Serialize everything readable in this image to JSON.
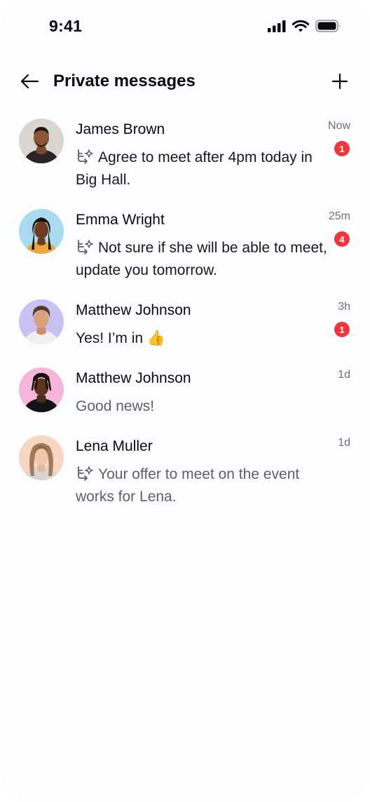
{
  "status_bar": {
    "time": "9:41",
    "icons": [
      "cellular-signal-icon",
      "wifi-icon",
      "battery-icon"
    ]
  },
  "header": {
    "title": "Private messages",
    "back_icon": "arrow-left-icon",
    "add_icon": "plus-icon"
  },
  "colors": {
    "badge": "#f0363d",
    "text_primary": "#0b0b0f",
    "text_secondary": "#5f5e69"
  },
  "conversations": [
    {
      "name": "James Brown",
      "message": "Agree to meet after 4pm today in Big Hall.",
      "time": "Now",
      "unread": "1",
      "has_ai_icon": true
    },
    {
      "name": "Emma Wright",
      "message": "Not sure if she will be able to meet, update you tomorrow.",
      "time": "25m",
      "unread": "4",
      "has_ai_icon": true
    },
    {
      "name": "Matthew Johnson",
      "message": "Yes! I’m in 👍",
      "time": "3h",
      "unread": "1",
      "has_ai_icon": false
    },
    {
      "name": "Matthew Johnson",
      "message": "Good news!",
      "time": "1d",
      "unread": null,
      "has_ai_icon": false
    },
    {
      "name": "Lena Muller",
      "message": "Your offer to meet on the event works for Lena.",
      "time": "1d",
      "unread": null,
      "has_ai_icon": true
    }
  ]
}
